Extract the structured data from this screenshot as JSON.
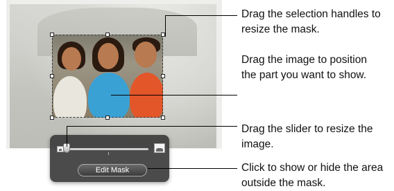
{
  "callouts": [
    "Drag the selection handles to resize the mask.",
    "Drag the image to position the part you want to show.",
    "Drag the slider to resize the image.",
    "Click to show or hide the area outside the mask."
  ],
  "hud": {
    "edit_mask_label": "Edit Mask",
    "zoom_level": 0.0
  },
  "icons": {
    "small": "small-image-icon",
    "large": "large-image-icon"
  },
  "colors": {
    "hud_bg": "#3c3c3c",
    "shirt_blue": "#3aa1d4",
    "shirt_orange": "#e2562a"
  }
}
